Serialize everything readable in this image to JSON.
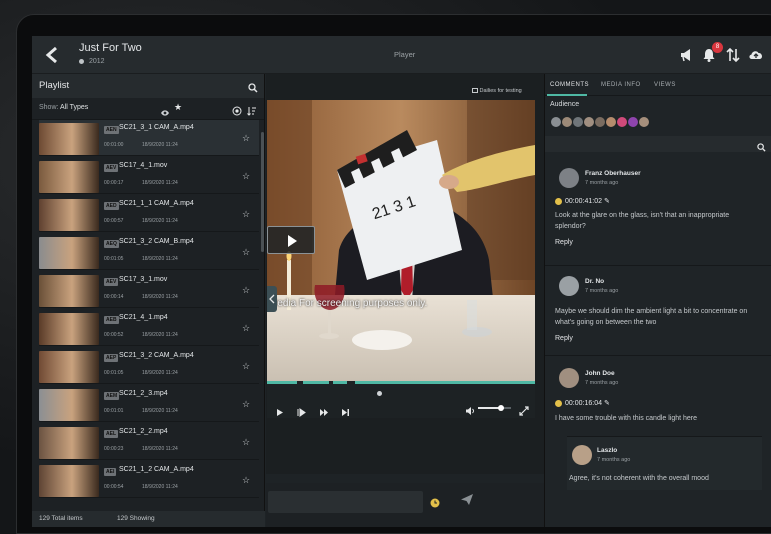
{
  "header": {
    "title": "Just For Two",
    "year": "2012",
    "player_label": "Player",
    "notification_count": "8"
  },
  "playlist": {
    "title": "Playlist",
    "show_label": "Show:",
    "show_value": "All Types",
    "items": [
      {
        "tag": "AEN",
        "name": "SC21_3_1 CAM_A.mp4",
        "duration": "00:01:00",
        "date": "18/9/2020 11:24"
      },
      {
        "tag": "AEV",
        "name": "SC17_4_1.mov",
        "duration": "00:00:17",
        "date": "18/9/2020 11:24"
      },
      {
        "tag": "AED",
        "name": "SC21_1_1 CAM_A.mp4",
        "duration": "00:00:57",
        "date": "18/9/2020 11:24"
      },
      {
        "tag": "AEQ",
        "name": "SC21_3_2 CAM_B.mp4",
        "duration": "00:01:05",
        "date": "18/9/2020 11:24"
      },
      {
        "tag": "AEV",
        "name": "SC17_3_1.mov",
        "duration": "00:00:14",
        "date": "18/9/2020 11:24"
      },
      {
        "tag": "AEB",
        "name": "SC21_4_1.mp4",
        "duration": "00:00:52",
        "date": "18/9/2020 11:24"
      },
      {
        "tag": "AEP",
        "name": "SC21_3_2 CAM_A.mp4",
        "duration": "00:01:05",
        "date": "18/9/2020 11:24"
      },
      {
        "tag": "AEM",
        "name": "SC21_2_3.mp4",
        "duration": "00:01:01",
        "date": "18/9/2020 11:24"
      },
      {
        "tag": "AEL",
        "name": "SC21_2_2.mp4",
        "duration": "00:00:23",
        "date": "18/9/2020 11:24"
      },
      {
        "tag": "AEI",
        "name": "SC21_1_2 CAM_A.mp4",
        "duration": "00:00:54",
        "date": "18/9/2020 11:24"
      }
    ],
    "total_items": "129 Total items",
    "showing": "129 Showing"
  },
  "player": {
    "dailies_label": "Dailies for testing",
    "watermark": "Media For screening purposes only.",
    "slate_numbers": "21 3 1",
    "volume_percent": 70
  },
  "comments_panel": {
    "tabs": [
      "COMMENTS",
      "MEDIA INFO",
      "VIEWS"
    ],
    "audience_label": "Audience",
    "audience_colors": [
      "#8a8f93",
      "#9c8a78",
      "#6f7579",
      "#a08f80",
      "#7a6c60",
      "#b58c6d",
      "#d04a7a",
      "#8e44ad",
      "#a58f7c"
    ],
    "comments": [
      {
        "name": "Franz Oberhauser",
        "ago": "7 months ago",
        "time": "00:00:41:02",
        "text": "Look at the glare on the glass, isn't that an inappropriate splendor?",
        "reply": "Reply"
      },
      {
        "name": "Dr. No",
        "ago": "7 months ago",
        "time": "",
        "text": "Maybe we should dim the ambient light a bit to concentrate on what's going on between the two",
        "reply": "Reply"
      },
      {
        "name": "John Doe",
        "ago": "7 months ago",
        "time": "00:00:16:04",
        "text": "I have some trouble with this candle light here",
        "reply": ""
      },
      {
        "name": "Laszlo",
        "ago": "7 months ago",
        "time": "",
        "text": "Agree, it's not coherent with the overall mood",
        "reply": ""
      }
    ]
  },
  "colors": {
    "accent": "#4fb8a4",
    "badge": "#d9363e",
    "clock": "#e3c04a"
  }
}
